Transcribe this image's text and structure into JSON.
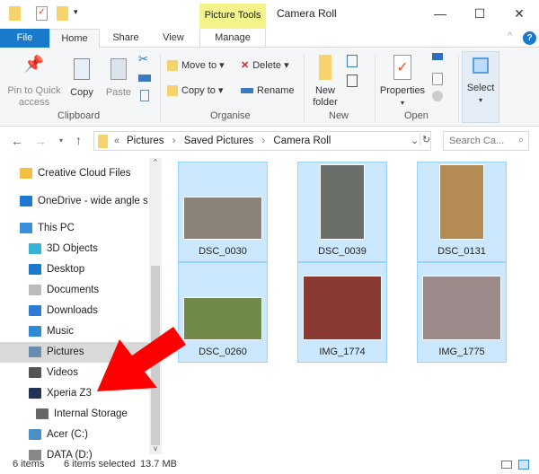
{
  "window": {
    "title": "Camera Roll",
    "context_tab": "Picture Tools",
    "minimize": "—",
    "maximize": "☐",
    "close": "✕"
  },
  "tabs": [
    {
      "label": "File"
    },
    {
      "label": "Home"
    },
    {
      "label": "Share"
    },
    {
      "label": "View"
    },
    {
      "label": "Manage"
    }
  ],
  "ribbon": {
    "clipboard": {
      "group": "Clipboard",
      "pin": "Pin to Quick access",
      "copy": "Copy",
      "paste": "Paste"
    },
    "organise": {
      "group": "Organise",
      "move_to": "Move to ▾",
      "copy_to": "Copy to ▾",
      "delete": "Delete ▾",
      "rename": "Rename"
    },
    "new": {
      "group": "New",
      "new_folder": "New folder"
    },
    "open": {
      "group": "Open",
      "properties": "Properties"
    },
    "select": {
      "label": "Select"
    }
  },
  "address": {
    "prefix": "«",
    "path": [
      "Pictures",
      "Saved Pictures",
      "Camera Roll"
    ],
    "search_placeholder": "Search Ca..."
  },
  "nav": {
    "items": [
      {
        "label": "Creative Cloud Files",
        "icon": "creative-cloud-icon",
        "color": "#f0c040"
      },
      {
        "label": "OneDrive - wide angle s",
        "icon": "onedrive-icon",
        "color": "#1e78d4"
      },
      {
        "label": "This PC",
        "icon": "computer-icon",
        "color": "#3a8fd6"
      },
      {
        "label": "3D Objects",
        "icon": "cube-icon",
        "color": "#37b3d6"
      },
      {
        "label": "Desktop",
        "icon": "desktop-icon",
        "color": "#1979ca"
      },
      {
        "label": "Documents",
        "icon": "document-icon",
        "color": "#bbbbbb"
      },
      {
        "label": "Downloads",
        "icon": "download-icon",
        "color": "#2c7cd6"
      },
      {
        "label": "Music",
        "icon": "music-icon",
        "color": "#2c8ad6"
      },
      {
        "label": "Pictures",
        "icon": "pictures-icon",
        "color": "#6a8cb0",
        "selected": true
      },
      {
        "label": "Videos",
        "icon": "videos-icon",
        "color": "#555555"
      },
      {
        "label": "Xperia Z3",
        "icon": "phone-icon",
        "color": "#223355"
      },
      {
        "label": "Internal Storage",
        "icon": "drive-icon",
        "color": "#666666"
      },
      {
        "label": "Acer (C:)",
        "icon": "drive-icon",
        "color": "#4a90c0"
      },
      {
        "label": "DATA (D:)",
        "icon": "drive-icon",
        "color": "#888888"
      }
    ]
  },
  "files": [
    {
      "name": "DSC_0030",
      "color": "#8a8278",
      "orient": "landscape"
    },
    {
      "name": "DSC_0039",
      "color": "#6b6f6a",
      "orient": "portrait"
    },
    {
      "name": "DSC_0131",
      "color": "#b48b52",
      "orient": "portrait"
    },
    {
      "name": "DSC_0260",
      "color": "#6f8a4a",
      "orient": "landscape"
    },
    {
      "name": "IMG_1774",
      "color": "#8a3a30",
      "orient": "square"
    },
    {
      "name": "IMG_1775",
      "color": "#9a8a8a",
      "orient": "square"
    }
  ],
  "status": {
    "count": "6 items",
    "selected": "6 items selected",
    "size": "13.7 MB"
  },
  "colors": {
    "accent": "#1979ca",
    "selection": "#cce8ff",
    "arrow": "#ff0000"
  }
}
